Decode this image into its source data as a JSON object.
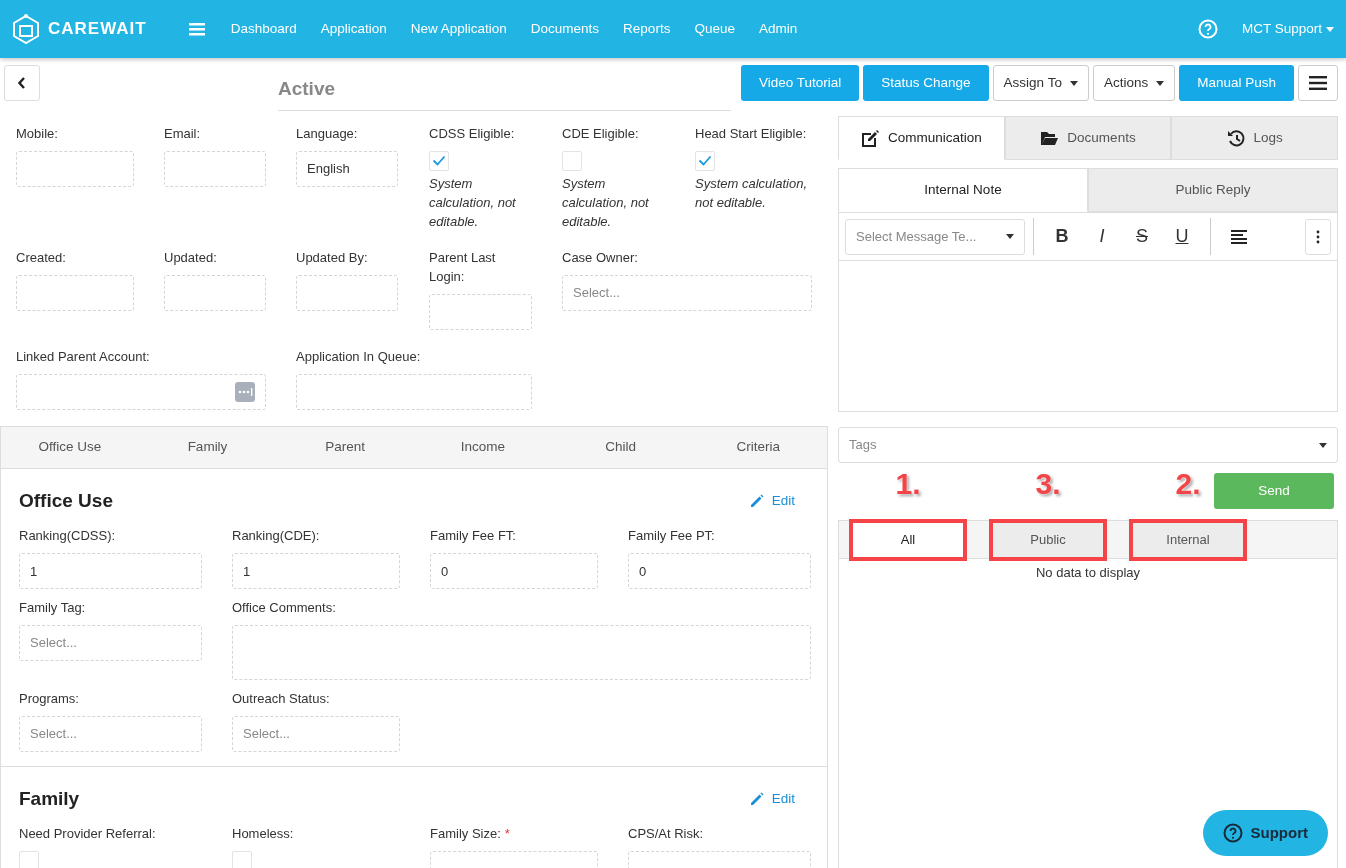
{
  "navbar": {
    "brand": "CAREWAIT",
    "links": [
      {
        "label": "Dashboard"
      },
      {
        "label": "Application"
      },
      {
        "label": "New Application"
      },
      {
        "label": "Documents"
      },
      {
        "label": "Reports"
      },
      {
        "label": "Queue"
      },
      {
        "label": "Admin"
      }
    ],
    "user": "MCT Support"
  },
  "header": {
    "status": "Active",
    "buttons": [
      {
        "label": "Video Tutorial",
        "kind": "primary"
      },
      {
        "label": "Status Change",
        "kind": "primary"
      },
      {
        "label": "Assign To",
        "kind": "dropdown"
      },
      {
        "label": "Actions",
        "kind": "dropdown"
      },
      {
        "label": "Manual Push",
        "kind": "primary"
      }
    ]
  },
  "summary_rows": [
    [
      {
        "label": "Mobile:",
        "kind": "text"
      },
      {
        "label": "Email:",
        "kind": "text"
      },
      {
        "label": "Language:",
        "kind": "text",
        "value": "English"
      },
      {
        "label": "CDSS Eligible:",
        "kind": "checkbox",
        "checked": true,
        "note": "System calculation, not editable."
      },
      {
        "label": "CDE Eligible:",
        "kind": "checkbox",
        "checked": false,
        "note": "System calculation, not editable."
      },
      {
        "label": "Head Start Eligible:",
        "kind": "checkbox",
        "checked": true,
        "note": "System calculation, not editable."
      }
    ],
    [
      {
        "label": "Created:",
        "kind": "text"
      },
      {
        "label": "Updated:",
        "kind": "text"
      },
      {
        "label": "Updated By:",
        "kind": "text"
      },
      {
        "label": "Parent Last Login:",
        "kind": "text"
      },
      {
        "label": "Case Owner:",
        "kind": "select",
        "placeholder": "Select..."
      }
    ],
    [
      {
        "label": "Linked Parent Account:",
        "kind": "lookup"
      },
      {
        "label": "Application In Queue:",
        "kind": "text"
      }
    ]
  ],
  "section_tabs": [
    {
      "label": "Office Use"
    },
    {
      "label": "Family"
    },
    {
      "label": "Parent"
    },
    {
      "label": "Income"
    },
    {
      "label": "Child"
    },
    {
      "label": "Criteria"
    }
  ],
  "sections": [
    {
      "title": "Office Use",
      "edit": "Edit",
      "rows": [
        [
          {
            "label": "Ranking(CDSS):",
            "kind": "text",
            "value": "1"
          },
          {
            "label": "Ranking(CDE):",
            "kind": "text",
            "value": "1"
          },
          {
            "label": "Family Fee FT:",
            "kind": "text",
            "value": "0"
          },
          {
            "label": "Family Fee PT:",
            "kind": "text",
            "value": "0"
          }
        ],
        [
          {
            "label": "Family Tag:",
            "kind": "select",
            "placeholder": "Select..."
          },
          {
            "label": "Office Comments:",
            "kind": "textarea"
          }
        ],
        [
          {
            "label": "Programs:",
            "kind": "select",
            "placeholder": "Select..."
          },
          {
            "label": "Outreach Status:",
            "kind": "select",
            "placeholder": "Select..."
          }
        ]
      ]
    },
    {
      "title": "Family",
      "edit": "Edit",
      "rows": [
        [
          {
            "label": "Need Provider Referral:",
            "kind": "checkbox",
            "checked": false
          },
          {
            "label": "Homeless:",
            "kind": "checkbox",
            "checked": false
          },
          {
            "label": "Family Size:",
            "kind": "text",
            "required_mark": "*"
          },
          {
            "label": "CPS/At Risk:",
            "kind": "text"
          }
        ]
      ]
    }
  ],
  "panel_tabs": [
    {
      "label": "Communication",
      "selected": true
    },
    {
      "label": "Documents",
      "selected": false
    },
    {
      "label": "Logs",
      "selected": false
    }
  ],
  "note_tabs": [
    {
      "label": "Internal Note",
      "selected": true
    },
    {
      "label": "Public Reply",
      "selected": false
    }
  ],
  "editor": {
    "template_placeholder": "Select Message Te...",
    "format_buttons": [
      {
        "label": "B",
        "kind": "bold"
      },
      {
        "label": "I",
        "kind": "italic"
      },
      {
        "label": "S",
        "kind": "strike"
      },
      {
        "label": "U",
        "kind": "underline"
      }
    ]
  },
  "tags": {
    "placeholder": "Tags"
  },
  "send": "Send",
  "filter_tabs": [
    {
      "label": "All",
      "selected": true,
      "annotation": "1."
    },
    {
      "label": "Public",
      "selected": false,
      "annotation": "3."
    },
    {
      "label": "Internal",
      "selected": false,
      "annotation": "2."
    }
  ],
  "empty_message": "No data to display",
  "support": "Support"
}
